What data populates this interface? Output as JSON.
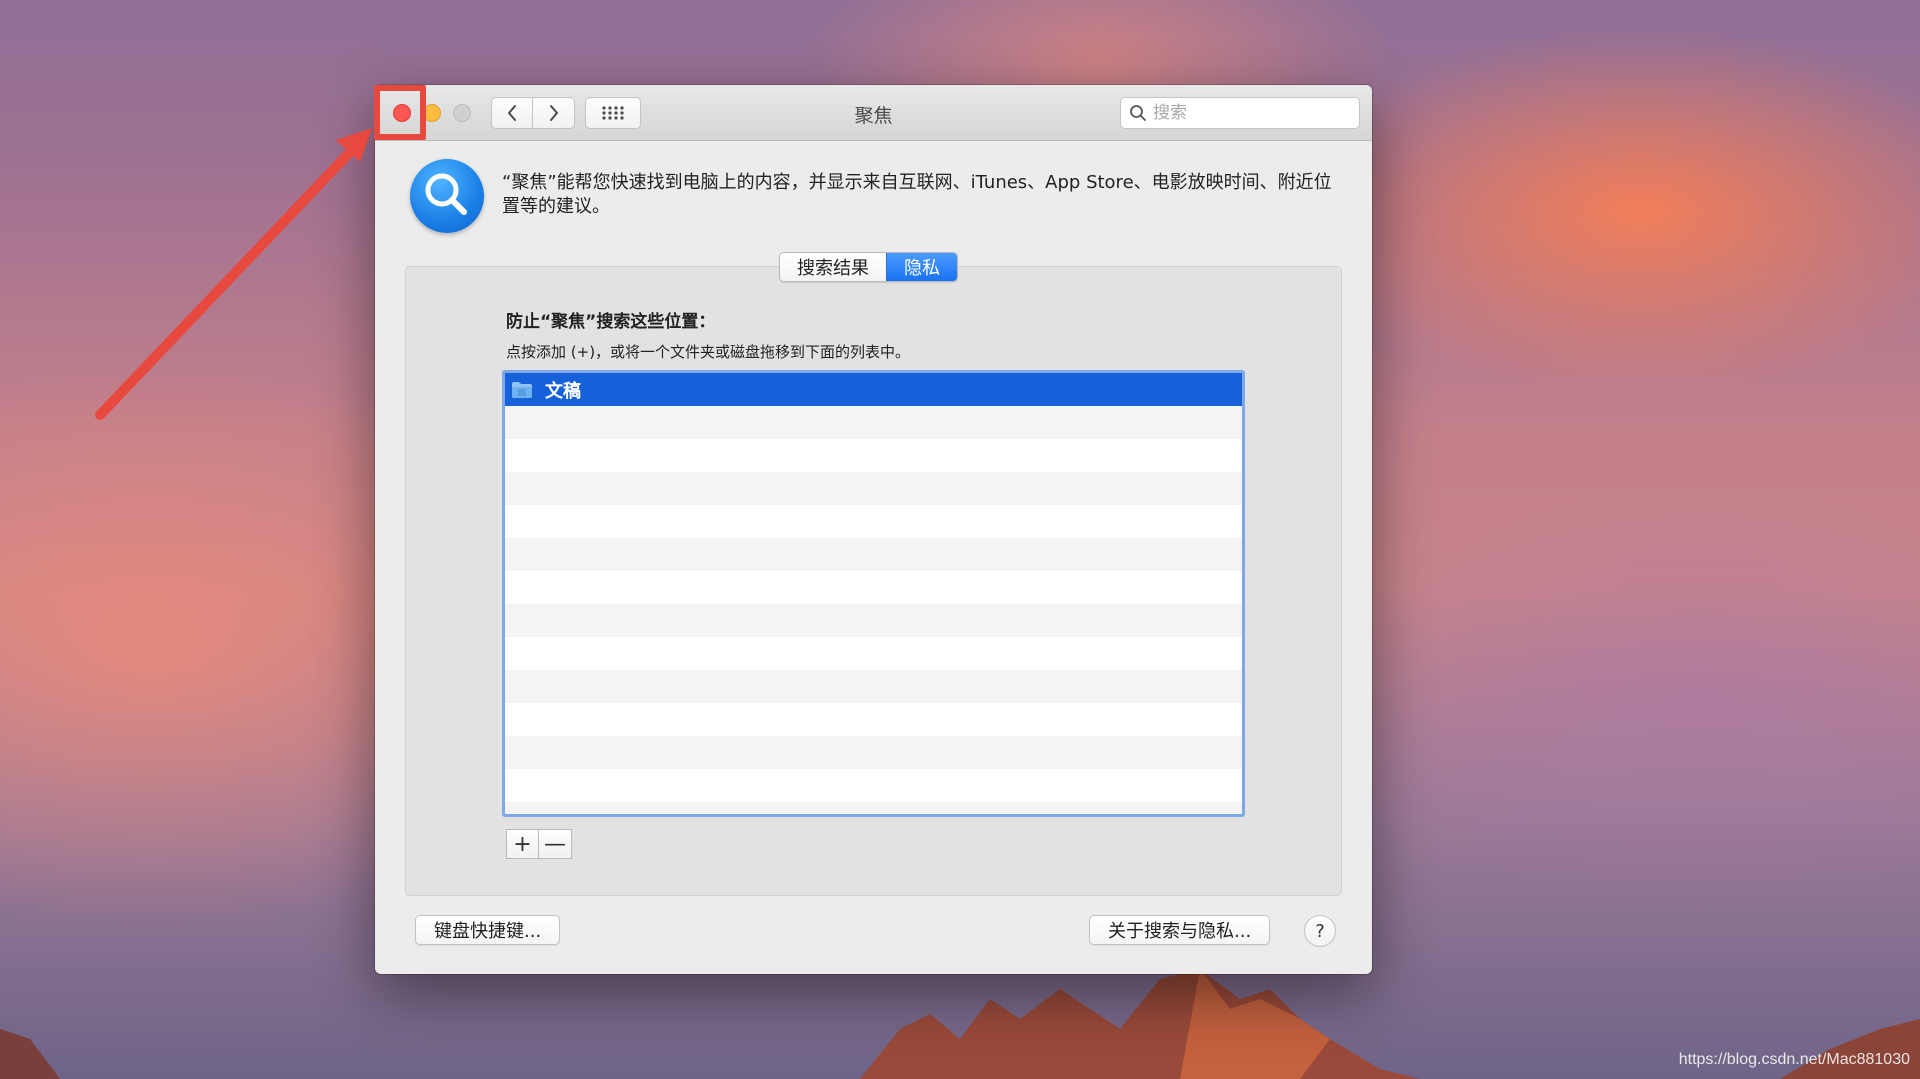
{
  "window": {
    "title": "聚焦",
    "search_placeholder": "搜索"
  },
  "header": {
    "description": "“聚焦”能帮您快速找到电脑上的内容，并显示来自互联网、iTunes、App Store、电影放映时间、附近位置等的建议。"
  },
  "tabs": [
    {
      "label": "搜索结果",
      "active": false
    },
    {
      "label": "隐私",
      "active": true
    }
  ],
  "privacy": {
    "title": "防止“聚焦”搜索这些位置：",
    "hint": "点按添加 (+)，或将一个文件夹或磁盘拖移到下面的列表中。",
    "items": [
      {
        "name": "文稿",
        "icon": "folder-icon",
        "selected": true
      }
    ],
    "add_label": "+",
    "remove_label": "—"
  },
  "footer": {
    "keyboard_shortcuts_label": "键盘快捷键...",
    "about_privacy_label": "关于搜索与隐私...",
    "help_label": "?"
  },
  "watermark": "https://blog.csdn.net/Mac881030",
  "colors": {
    "accent": "#1661d9",
    "annotation": "#e8493f"
  }
}
